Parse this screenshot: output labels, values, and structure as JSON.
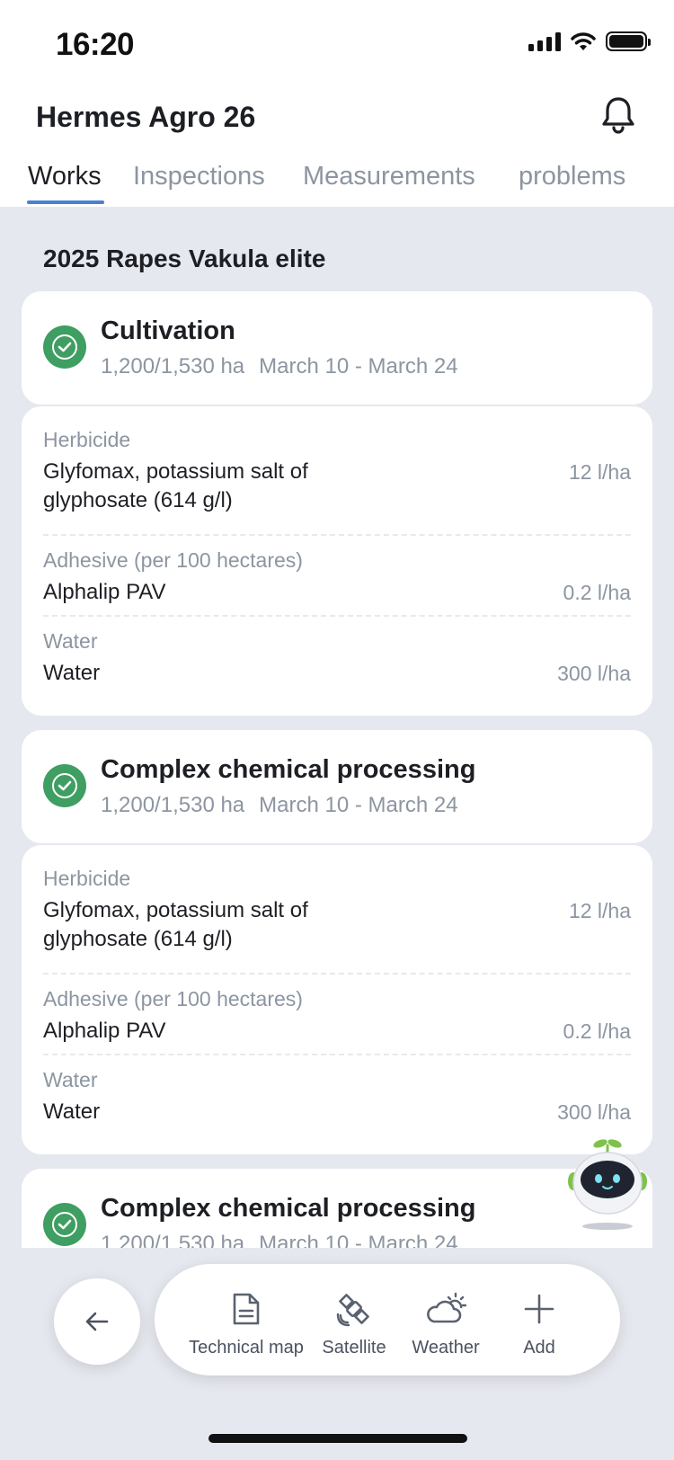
{
  "status_bar": {
    "time": "16:20"
  },
  "header": {
    "title": "Hermes Agro 26"
  },
  "tabs": [
    "Works",
    "Inspections",
    "Measurements",
    "problems"
  ],
  "section_title": "2025 Rapes Vakula elite",
  "works": [
    {
      "title": "Cultivation",
      "area": "1,200/1,530 ha",
      "dates": "March 10 - March 24",
      "items": [
        {
          "category": "Herbicide",
          "name": "Glyfomax, potassium salt of glyphosate (614 g/l)",
          "rate": "12 l/ha"
        },
        {
          "category": "Adhesive (per 100 hectares)",
          "name": "Alphalip PAV",
          "rate": "0.2 l/ha"
        },
        {
          "category": "Water",
          "name": "Water",
          "rate": "300 l/ha"
        }
      ]
    },
    {
      "title": "Complex chemical processing",
      "area": "1,200/1,530 ha",
      "dates": "March 10 - March 24",
      "items": [
        {
          "category": "Herbicide",
          "name": "Glyfomax, potassium salt of glyphosate (614 g/l)",
          "rate": "12 l/ha"
        },
        {
          "category": "Adhesive (per 100 hectares)",
          "name": "Alphalip PAV",
          "rate": "0.2 l/ha"
        },
        {
          "category": "Water",
          "name": "Water",
          "rate": "300 l/ha"
        }
      ]
    },
    {
      "title": "Complex chemical processing",
      "area": "1,200/1,530 ha",
      "dates": "March 10 - March 24"
    }
  ],
  "toolbar": {
    "technical_map": "Technical map",
    "satellite": "Satellite",
    "weather": "Weather",
    "add": "Add"
  },
  "icons": {
    "back": "arrow-left-icon",
    "bell": "bell-icon",
    "check": "check-circle-icon",
    "technical_map": "document-icon",
    "satellite": "satellite-icon",
    "weather": "partly-cloudy-icon",
    "add": "plus-icon",
    "assistant": "robot-assistant-icon"
  },
  "colors": {
    "accent": "#4a7fd4",
    "success": "#3f9e61",
    "background": "#e6e8ef",
    "muted_text": "#8c95a1"
  }
}
